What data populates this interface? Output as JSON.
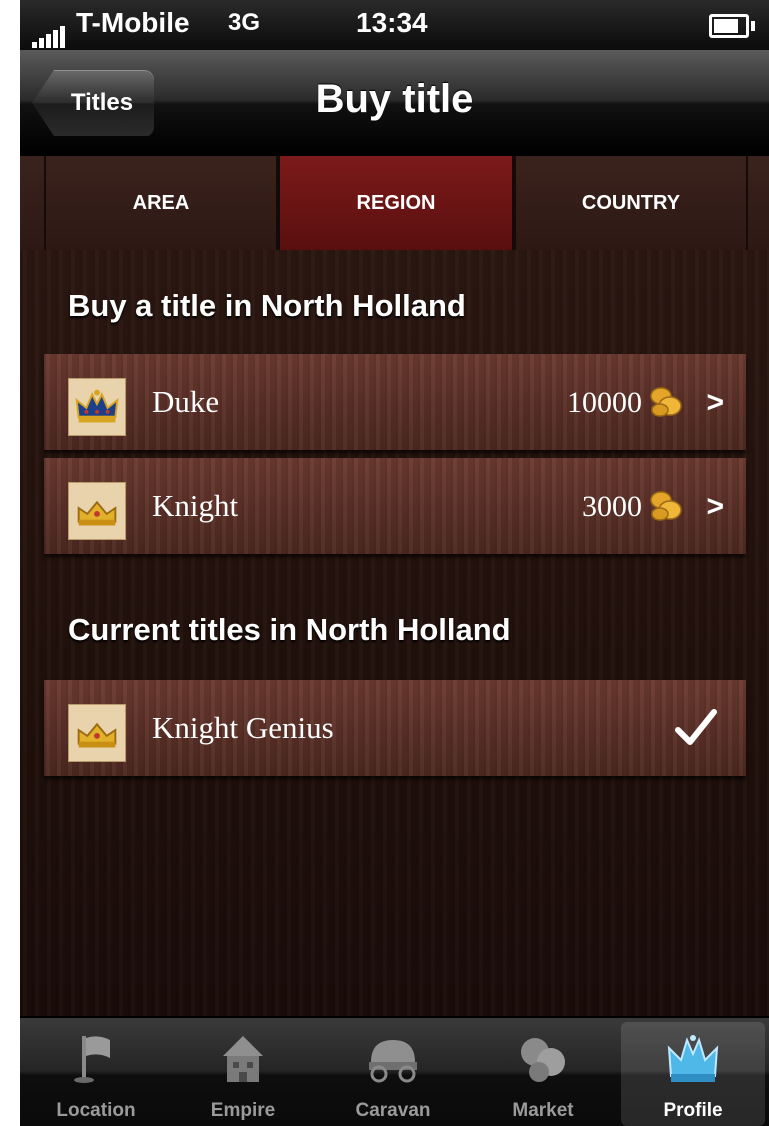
{
  "status": {
    "carrier": "T-Mobile",
    "network": "3G",
    "time": "13:34"
  },
  "nav": {
    "back_label": "Titles",
    "title": "Buy title"
  },
  "segments": [
    {
      "label": "AREA"
    },
    {
      "label": "REGION",
      "active": true
    },
    {
      "label": "COUNTRY"
    }
  ],
  "buy": {
    "heading": "Buy a title in North Holland",
    "items": [
      {
        "name": "Duke",
        "price": "10000",
        "icon": "duke-crown-icon"
      },
      {
        "name": "Knight",
        "price": "3000",
        "icon": "knight-crown-icon"
      }
    ]
  },
  "current": {
    "heading": "Current titles in North Holland",
    "items": [
      {
        "name": "Knight Genius",
        "icon": "knight-crown-icon"
      }
    ]
  },
  "tabbar": {
    "items": [
      {
        "label": "Location",
        "icon": "flag-icon"
      },
      {
        "label": "Empire",
        "icon": "house-icon"
      },
      {
        "label": "Caravan",
        "icon": "wagon-icon"
      },
      {
        "label": "Market",
        "icon": "coins-icon"
      },
      {
        "label": "Profile",
        "icon": "crown-icon",
        "active": true
      }
    ]
  },
  "colors": {
    "active_tab": "#7c1a1a",
    "wood_row": "#5a3128",
    "background": "#1c0e0b"
  }
}
